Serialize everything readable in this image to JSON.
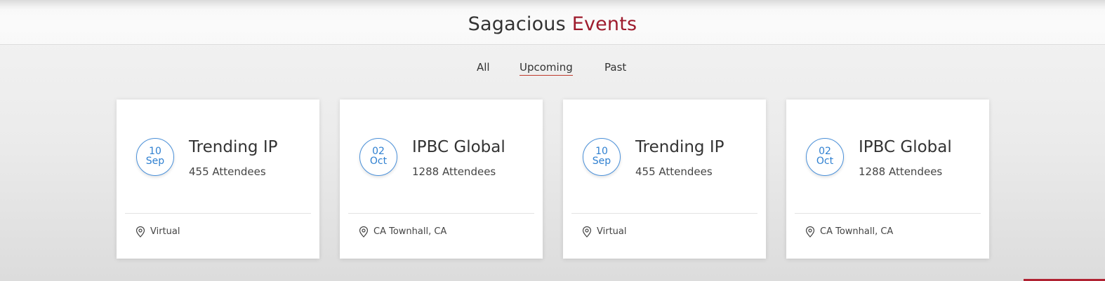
{
  "section": {
    "title_main": "Sagacious",
    "title_accent": "Events"
  },
  "tabs": [
    {
      "label": "All",
      "active": false
    },
    {
      "label": "Upcoming",
      "active": true
    },
    {
      "label": "Past",
      "active": false
    }
  ],
  "events": [
    {
      "day": "10",
      "month": "Sep",
      "title": "Trending IP",
      "attendees": "455 Attendees",
      "location": "Virtual"
    },
    {
      "day": "02",
      "month": "Oct",
      "title": "IPBC Global",
      "attendees": "1288 Attendees",
      "location": "CA Townhall, CA"
    },
    {
      "day": "10",
      "month": "Sep",
      "title": "Trending IP",
      "attendees": "455 Attendees",
      "location": "Virtual"
    },
    {
      "day": "02",
      "month": "Oct",
      "title": "IPBC Global",
      "attendees": "1288 Attendees",
      "location": "CA Townhall, CA"
    }
  ],
  "colors": {
    "accent": "#9e1b2d",
    "date_blue": "#2f80d1",
    "tab_underline": "#c0392b"
  },
  "icons": {
    "location": "map-pin-icon"
  }
}
